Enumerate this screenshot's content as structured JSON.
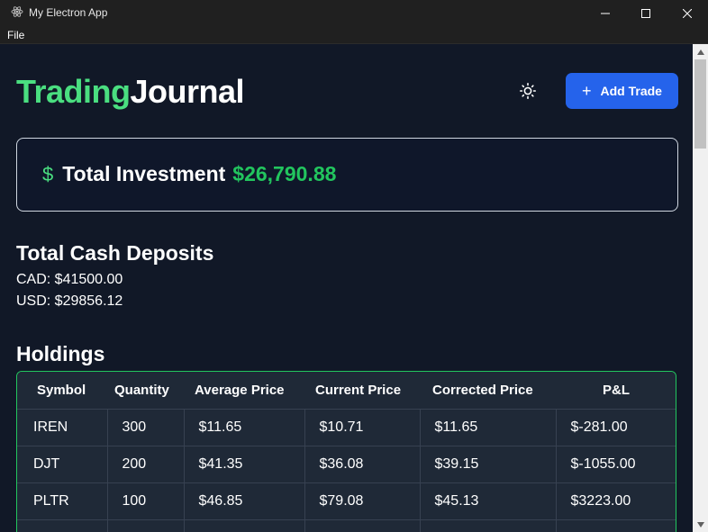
{
  "window": {
    "title": "My Electron App",
    "menu": [
      "File"
    ]
  },
  "header": {
    "logo_part1": "Trading",
    "logo_part2": "Journal",
    "theme_icon": "sun-icon",
    "add_trade_label": "Add Trade"
  },
  "investment": {
    "label": "Total Investment",
    "value": "$26,790.88"
  },
  "deposits": {
    "title": "Total Cash Deposits",
    "cad": "CAD: $41500.00",
    "usd": "USD: $29856.12"
  },
  "holdings": {
    "title": "Holdings",
    "columns": [
      "Symbol",
      "Quantity",
      "Average Price",
      "Current Price",
      "Corrected Price",
      "P&L"
    ],
    "rows": [
      [
        "IREN",
        "300",
        "$11.65",
        "$10.71",
        "$11.65",
        "$-281.00"
      ],
      [
        "DJT",
        "200",
        "$41.35",
        "$36.08",
        "$39.15",
        "$-1055.00"
      ],
      [
        "PLTR",
        "100",
        "$46.85",
        "$79.08",
        "$45.13",
        "$3223.00"
      ]
    ]
  },
  "colors": {
    "accent_green": "#4ade80",
    "value_green": "#22c55e",
    "button_blue": "#2563eb",
    "background": "#111827"
  }
}
